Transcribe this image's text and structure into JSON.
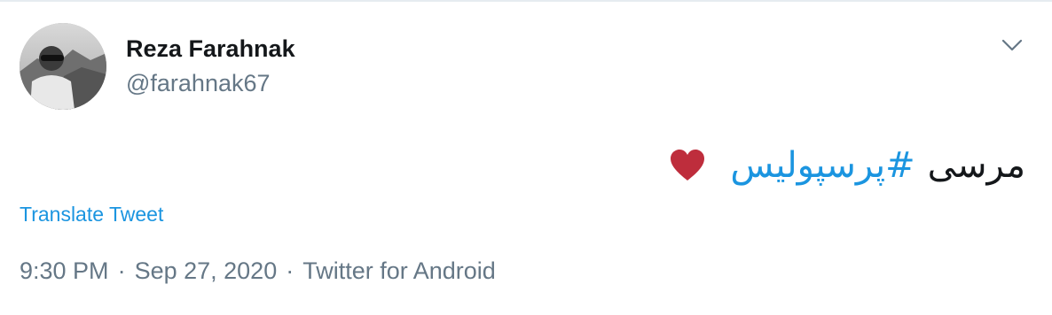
{
  "author": {
    "display_name": "Reza Farahnak",
    "handle": "@farahnak67",
    "avatar_icon": "profile-photo"
  },
  "menu": {
    "icon": "chevron-down-icon"
  },
  "tweet": {
    "word": "مرسی",
    "hashtag": "#پرسپولیس",
    "emoji_icon": "red-heart-icon",
    "heart_color": "#be2d3c"
  },
  "translate": {
    "label": "Translate Tweet"
  },
  "meta": {
    "time": "9:30 PM",
    "separator": "·",
    "date": "Sep 27, 2020",
    "source": "Twitter for Android"
  },
  "colors": {
    "link": "#1b95e0",
    "secondary_text": "#657786",
    "primary_text": "#14171a",
    "divider": "#e6ecf0"
  }
}
